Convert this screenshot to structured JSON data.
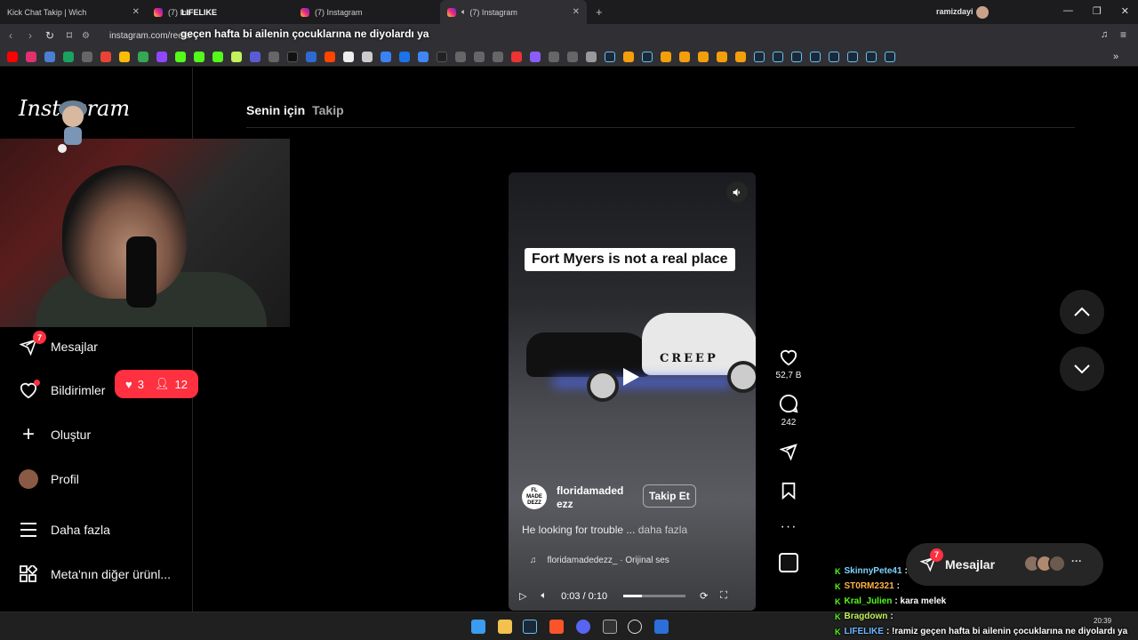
{
  "browser": {
    "tabs": [
      {
        "title": "Kick Chat Takip | Wich",
        "active": false
      },
      {
        "title": "(7) Ins",
        "active": false
      },
      {
        "title": "(7) Instagram",
        "active": false
      },
      {
        "title": "(7) Instagram",
        "active": true
      }
    ],
    "profile_name": "ramizdayi",
    "url": "instagram.com/reels/",
    "colors": {
      "tabbar": "#1c1c1e",
      "toolbar": "#303034"
    }
  },
  "stream_overlay": {
    "top_name": "LIFELIKE",
    "url_message": "geçen hafta bi ailenin çocuklarına ne diyolardı ya"
  },
  "sidebar": {
    "logo": "Instagram",
    "items": [
      {
        "label": "Mesajlar",
        "icon": "send-icon",
        "badge": "7"
      },
      {
        "label": "Bildirimler",
        "icon": "heart-icon"
      },
      {
        "label": "Oluştur",
        "icon": "plus-icon"
      },
      {
        "label": "Profil",
        "icon": "avatar"
      },
      {
        "label": "Daha fazla",
        "icon": "menu-icon"
      },
      {
        "label": "Meta'nın diğer ürünl...",
        "icon": "grid-icon"
      }
    ],
    "notif_pill": {
      "likes": "3",
      "follows": "12"
    }
  },
  "feed": {
    "tabs": [
      "Senin için",
      "Takip"
    ]
  },
  "reel": {
    "caption": "Fort Myers is not a real place",
    "car_text": "CREEP",
    "author_handle": "floridamadedezz",
    "author_avatar_text": "FL MADE DEZZ",
    "follow_label": "Takip Et",
    "description": "He looking for trouble ...",
    "more_label": "daha fazla",
    "audio": "floridamadedezz_ · Orijinal ses",
    "time": "0:03 / 0:10",
    "progress": 0.3,
    "likes": "52,7 B",
    "comments": "242"
  },
  "floating_messages": {
    "label": "Mesajlar",
    "badge": "7"
  },
  "chat": [
    {
      "user": "SkinnyPete41",
      "message": ":",
      "color": "#7fd4ff"
    },
    {
      "user": "ST0RM2321",
      "message": ":",
      "color": "#ffb347"
    },
    {
      "user": "Kral_Julien",
      "message": ": kara melek",
      "color": "#53fc18"
    },
    {
      "user": "Bragdown",
      "message": ":",
      "color": "#c3f25c"
    },
    {
      "user": "LIFELIKE",
      "message": ": !ramiz geçen hafta bi ailenin çocuklarına ne diyolardı ya",
      "color": "#6fb8ff"
    }
  ],
  "taskbar": {
    "time": "20:39"
  }
}
